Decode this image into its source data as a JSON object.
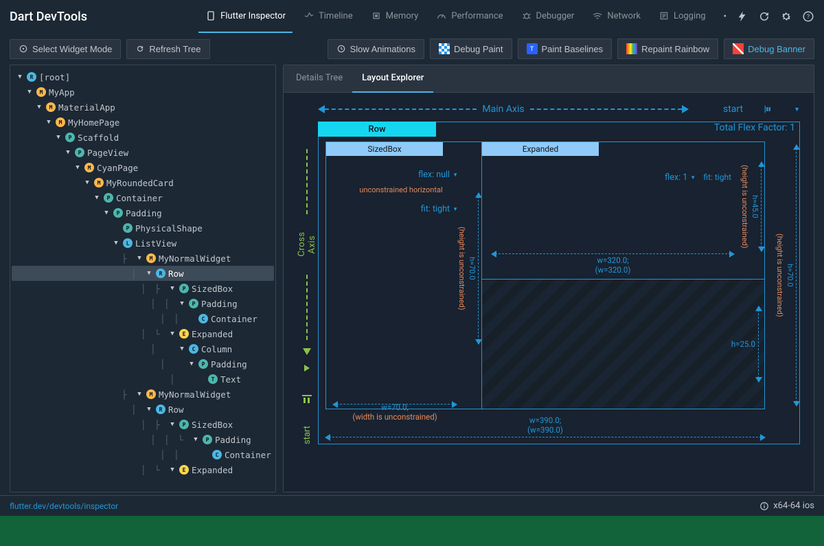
{
  "header": {
    "title": "Dart DevTools",
    "tabs": [
      {
        "label": "Flutter Inspector",
        "icon": "phone-icon",
        "active": true
      },
      {
        "label": "Timeline",
        "icon": "timeline-icon"
      },
      {
        "label": "Memory",
        "icon": "memory-icon"
      },
      {
        "label": "Performance",
        "icon": "gauge-icon"
      },
      {
        "label": "Debugger",
        "icon": "bug-icon"
      },
      {
        "label": "Network",
        "icon": "network-icon"
      },
      {
        "label": "Logging",
        "icon": "log-icon"
      }
    ],
    "top_icons": [
      "overflow-icon",
      "bolt-icon",
      "refresh-icon",
      "gear-icon",
      "help-icon"
    ]
  },
  "toolbar": {
    "select_widget": "Select Widget Mode",
    "refresh_tree": "Refresh Tree",
    "slow_animations": "Slow Animations",
    "debug_paint": "Debug Paint",
    "paint_baselines": "Paint Baselines",
    "repaint_rainbow": "Repaint Rainbow",
    "debug_banner": "Debug Banner"
  },
  "tree": [
    {
      "depth": 0,
      "arrow": "down",
      "badge": "R",
      "label": "[root]"
    },
    {
      "depth": 1,
      "arrow": "down",
      "badge": "M",
      "label": "MyApp"
    },
    {
      "depth": 2,
      "arrow": "down",
      "badge": "M",
      "label": "MaterialApp"
    },
    {
      "depth": 3,
      "arrow": "down",
      "badge": "M",
      "label": "MyHomePage"
    },
    {
      "depth": 4,
      "arrow": "down",
      "badge": "P",
      "label": "Scaffold"
    },
    {
      "depth": 5,
      "arrow": "down",
      "badge": "P",
      "label": "PageView"
    },
    {
      "depth": 6,
      "arrow": "down",
      "badge": "M",
      "label": "CyanPage"
    },
    {
      "depth": 7,
      "arrow": "down",
      "badge": "M",
      "label": "MyRoundedCard"
    },
    {
      "depth": 8,
      "arrow": "down",
      "badge": "P",
      "label": "Container"
    },
    {
      "depth": 9,
      "arrow": "down",
      "badge": "P",
      "label": "Padding"
    },
    {
      "depth": 10,
      "arrow": "blank",
      "badge": "P",
      "label": "PhysicalShape"
    },
    {
      "depth": 10,
      "arrow": "down",
      "badge": "L",
      "label": "ListView"
    },
    {
      "depth": 11,
      "arrow": "down",
      "badge": "M",
      "label": "MyNormalWidget",
      "guides": [
        "├"
      ]
    },
    {
      "depth": 12,
      "arrow": "down",
      "badge": "R",
      "label": "Row",
      "selected": true,
      "guides": [
        "│"
      ]
    },
    {
      "depth": 13,
      "arrow": "down",
      "badge": "P",
      "label": "SizedBox",
      "guides": [
        "│",
        "├"
      ]
    },
    {
      "depth": 14,
      "arrow": "down",
      "badge": "P",
      "label": "Padding",
      "guides": [
        "│",
        "│"
      ]
    },
    {
      "depth": 15,
      "arrow": "blank",
      "badge": "C",
      "label": "Container",
      "guides": [
        "│",
        "│"
      ]
    },
    {
      "depth": 13,
      "arrow": "down",
      "badge": "E",
      "label": "Expanded",
      "guides": [
        "│",
        "└"
      ]
    },
    {
      "depth": 14,
      "arrow": "down",
      "badge": "C",
      "label": "Column",
      "guides": [
        "│",
        " "
      ]
    },
    {
      "depth": 15,
      "arrow": "down",
      "badge": "P",
      "label": "Padding",
      "guides": [
        "│",
        " "
      ]
    },
    {
      "depth": 16,
      "arrow": "blank",
      "badge": "T",
      "label": "Text",
      "guides": [
        "│",
        " "
      ]
    },
    {
      "depth": 11,
      "arrow": "down",
      "badge": "M",
      "label": "MyNormalWidget",
      "guides": [
        "├"
      ]
    },
    {
      "depth": 12,
      "arrow": "down",
      "badge": "R",
      "label": "Row",
      "guides": [
        "│"
      ]
    },
    {
      "depth": 13,
      "arrow": "down",
      "badge": "P",
      "label": "SizedBox",
      "guides": [
        "│",
        "├"
      ]
    },
    {
      "depth": 14,
      "arrow": "down",
      "badge": "P",
      "label": "Padding",
      "guides": [
        "│",
        "│",
        "└"
      ]
    },
    {
      "depth": 15,
      "arrow": "blank",
      "badge": "C",
      "label": "Container",
      "guides": [
        "│",
        "│",
        " "
      ]
    },
    {
      "depth": 13,
      "arrow": "down",
      "badge": "E",
      "label": "Expanded",
      "guides": [
        "│",
        "└"
      ]
    }
  ],
  "subtabs": {
    "details_tree": "Details Tree",
    "layout_explorer": "Layout Explorer"
  },
  "layout": {
    "main_axis": "Main Axis",
    "cross_axis": "Cross Axis",
    "main_align": "start",
    "cross_align": "start",
    "row_label": "Row",
    "total_flex": "Total Flex Factor: 1",
    "sizedbox": "SizedBox",
    "expanded": "Expanded",
    "flex_null": "flex: null",
    "unconstrained_h": "unconstrained horizontal",
    "fit_tight": "fit: tight",
    "height_unconstrained": "(height is unconstrained)",
    "width_unconstrained": "(width is unconstrained)",
    "w70": "w=70.0;",
    "h70": "h=70.0",
    "flex1": "flex: 1",
    "fit_tight2": "fit: tight",
    "w320": "w=320.0;",
    "w320b": "(w=320.0)",
    "h45": "h=45.0",
    "h25": "h=25.0",
    "w390": "w=390.0;",
    "w390b": "(w=390.0)"
  },
  "statusbar": {
    "link": "flutter.dev/devtools/inspector",
    "platform": "x64-64 ios"
  },
  "colors": {
    "accent": "#4db6e2",
    "blue": "#2196d6",
    "green": "#8bc34a",
    "warn": "#e68a5c",
    "bg": "#1c2834"
  }
}
